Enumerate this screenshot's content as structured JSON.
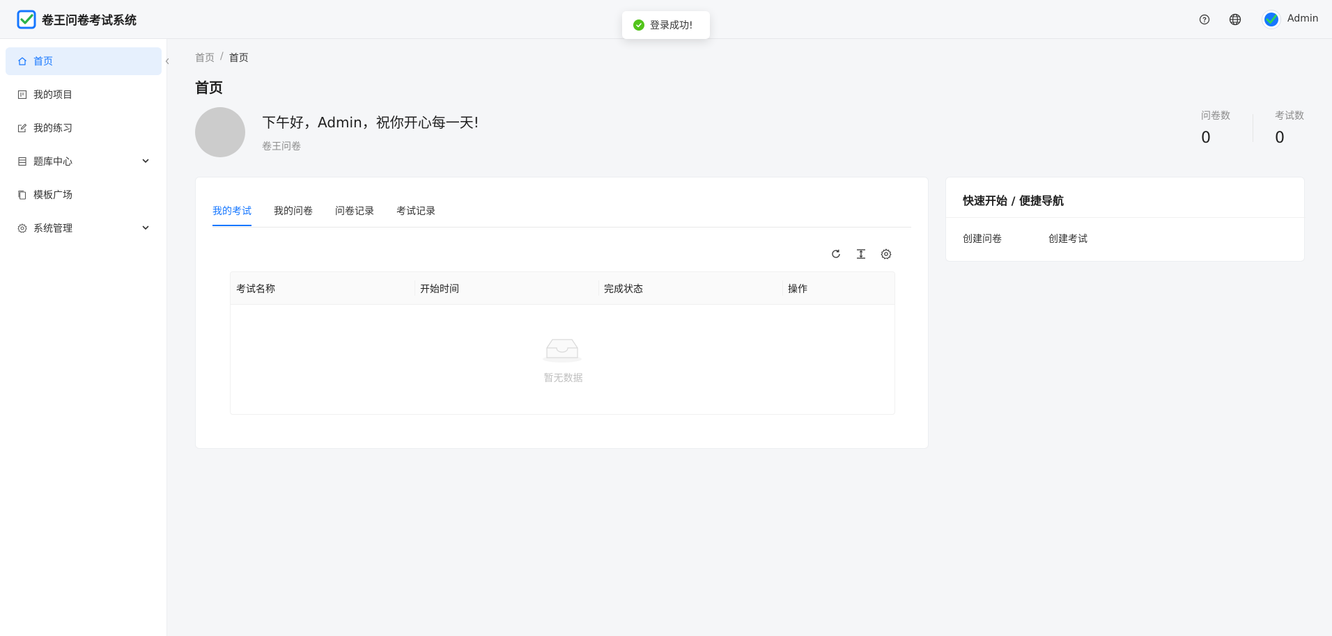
{
  "app": {
    "title": "卷王问卷考试系统",
    "user_name": "Admin",
    "icons": {
      "help": "question-circle-icon",
      "language": "globe-icon"
    }
  },
  "toast": {
    "message": "登录成功!",
    "status_color": "#52c41a"
  },
  "sidebar": {
    "items": [
      {
        "label": "首页",
        "icon": "home-icon",
        "active": true
      },
      {
        "label": "我的项目",
        "icon": "project-icon"
      },
      {
        "label": "我的练习",
        "icon": "edit-icon"
      },
      {
        "label": "题库中心",
        "icon": "database-icon",
        "expandable": true
      },
      {
        "label": "模板广场",
        "icon": "copy-icon"
      },
      {
        "label": "系统管理",
        "icon": "gear-icon",
        "expandable": true
      }
    ],
    "accent_color": "#1677ff"
  },
  "breadcrumb": {
    "root": "首页",
    "separator": "/",
    "current": "首页"
  },
  "page": {
    "title": "首页",
    "greeting": "下午好，Admin，祝你开心每一天!",
    "subtitle": "卷王问卷"
  },
  "stats": [
    {
      "label": "问卷数",
      "value": "0"
    },
    {
      "label": "考试数",
      "value": "0"
    }
  ],
  "main": {
    "tabs": [
      {
        "label": "我的考试",
        "active": true
      },
      {
        "label": "我的问卷"
      },
      {
        "label": "问卷记录"
      },
      {
        "label": "考试记录"
      }
    ],
    "toolbar_icons": [
      "reload-icon",
      "column-height-icon",
      "setting-icon"
    ],
    "table": {
      "columns": [
        "考试名称",
        "开始时间",
        "完成状态",
        "操作"
      ],
      "empty_text": "暂无数据"
    }
  },
  "quick": {
    "title": "快速开始 / 便捷导航",
    "links": [
      "创建问卷",
      "创建考试"
    ]
  }
}
